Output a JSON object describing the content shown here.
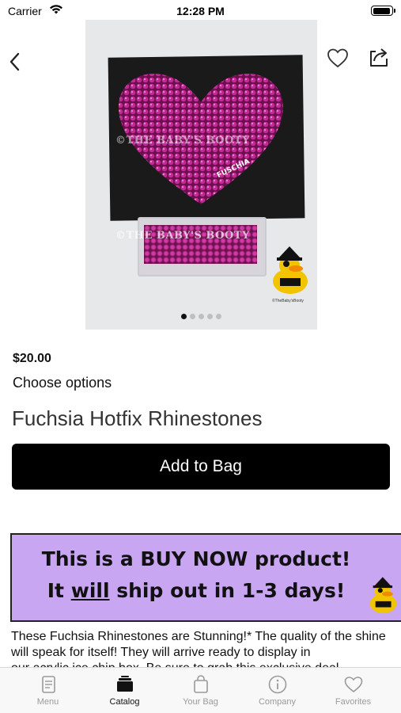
{
  "status_bar": {
    "carrier": "Carrier",
    "time": "12:28 PM"
  },
  "product": {
    "image": {
      "watermark": "©THE BABY'S BOOTY",
      "gem_label": "FUSCHIA",
      "duck_caption": "©TheBaby'sBooty",
      "page_count": 5,
      "active_page": 1
    },
    "price": "$20.00",
    "options_label": "Choose options",
    "title": "Fuchsia Hotfix Rhinestones",
    "add_button_label": "Add to Bag"
  },
  "banner": {
    "line1": "This is a BUY NOW product!",
    "line2_pre": "It ",
    "line2_emphasis": "will",
    "line2_post": " ship out in 1-3 days!",
    "background": "#c9a6f2"
  },
  "description": {
    "text": "These Fuchsia Rhinestones are Stunning!* The quality of the shine will speak for itself!   They will arrive ready to display in",
    "cut_line": "our acrylic ice chip box. Be sure to grab this exclusive deal"
  },
  "tab_bar": {
    "items": [
      {
        "label": "Menu",
        "icon": "menu-book-icon",
        "active": false
      },
      {
        "label": "Catalog",
        "icon": "catalog-icon",
        "active": true
      },
      {
        "label": "Your Bag",
        "icon": "bag-icon",
        "active": false
      },
      {
        "label": "Company",
        "icon": "info-icon",
        "active": false
      },
      {
        "label": "Favorites",
        "icon": "heart-icon",
        "active": false
      }
    ]
  },
  "colors": {
    "accent": "#000000",
    "gem": "#d23aa5",
    "banner": "#c9a6f2",
    "tab_inactive": "#9a9a9a"
  }
}
